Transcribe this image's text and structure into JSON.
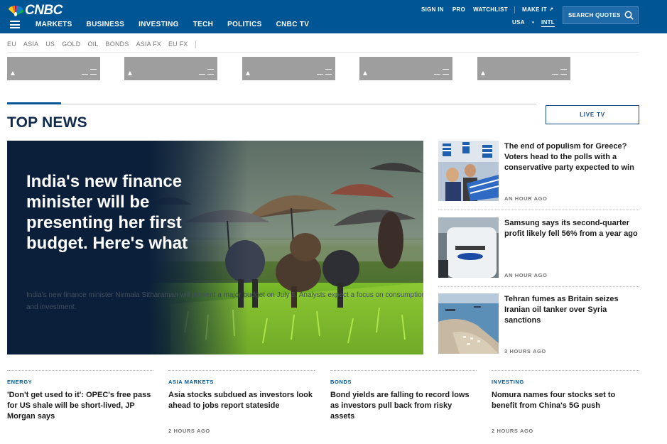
{
  "header": {
    "logo_text": "CNBC",
    "nav": [
      "MARKETS",
      "BUSINESS",
      "INVESTING",
      "TECH",
      "POLITICS",
      "CNBC TV"
    ],
    "sign_in": "SIGN IN",
    "pro": "PRO",
    "watchlist": "WATCHLIST",
    "make_it": "MAKE IT ↗",
    "region_usa": "USA",
    "region_sep": "•",
    "region_intl": "INTL",
    "search_label": "SEARCH QUOTES",
    "colors": {
      "bar": "#005594",
      "accent": "#1f6aa8"
    }
  },
  "markets": {
    "tabs": [
      "EU",
      "ASIA",
      "US",
      "GOLD",
      "OIL",
      "BONDS",
      "ASIA FX",
      "EU FX"
    ],
    "quote_cards": 5
  },
  "top_news": {
    "section_title": "TOP NEWS",
    "live_tv": "LIVE TV",
    "hero": {
      "title": "India's new finance minister will be presenting her first budget. Here's what",
      "description": "India's new finance minister Nirmala Sitharaman will present a major budget on July 5. Analysts expect a focus on consumption and investment."
    },
    "side": [
      {
        "title": "The end of populism for Greece? Voters head to the polls with a conservative party expected to win",
        "time": "AN HOUR AGO",
        "thumb": "greece-rally-photo"
      },
      {
        "title": "Samsung says its second-quarter profit likely fell 56% from a year ago",
        "time": "AN HOUR AGO",
        "thumb": "samsung-sign-photo"
      },
      {
        "title": "Tehran fumes as Britain seizes Iranian oil tanker over Syria sanctions",
        "time": "3 HOURS AGO",
        "thumb": "gibraltar-aerial-photo"
      }
    ]
  },
  "bottom": [
    {
      "category": "ENERGY",
      "title": "'Don't get used to it': OPEC's free pass for US shale will be short-lived, JP Morgan says",
      "time": ""
    },
    {
      "category": "ASIA MARKETS",
      "title": "Asia stocks subdued as investors look ahead to jobs report stateside",
      "time": "2 HOURS AGO"
    },
    {
      "category": "BONDS",
      "title": "Bond yields are falling to record lows as investors pull back from risky assets",
      "time": ""
    },
    {
      "category": "INVESTING",
      "title": "Nomura names four stocks set to benefit from China's 5G push",
      "time": "2 HOURS AGO"
    }
  ]
}
